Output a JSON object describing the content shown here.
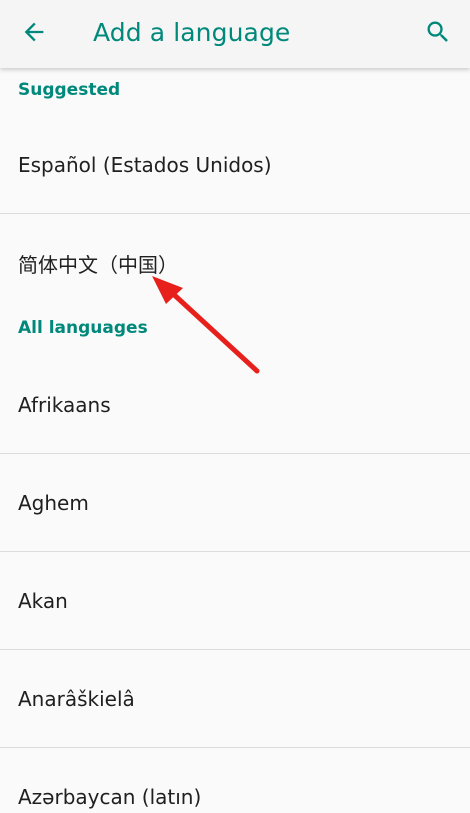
{
  "header": {
    "back_icon": "arrow-left-icon",
    "title": "Add a language",
    "search_icon": "search-icon"
  },
  "sections": {
    "suggested": {
      "label": "Suggested",
      "items": [
        "Español (Estados Unidos)",
        "简体中文（中国）"
      ]
    },
    "all": {
      "label": "All languages",
      "items": [
        "Afrikaans",
        "Aghem",
        "Akan",
        "Anarâškielâ",
        "Azərbaycan (latın)"
      ]
    }
  },
  "colors": {
    "accent": "#00897b",
    "annotation_arrow": "#e8201c",
    "text": "#202020",
    "background": "#fafafa"
  }
}
